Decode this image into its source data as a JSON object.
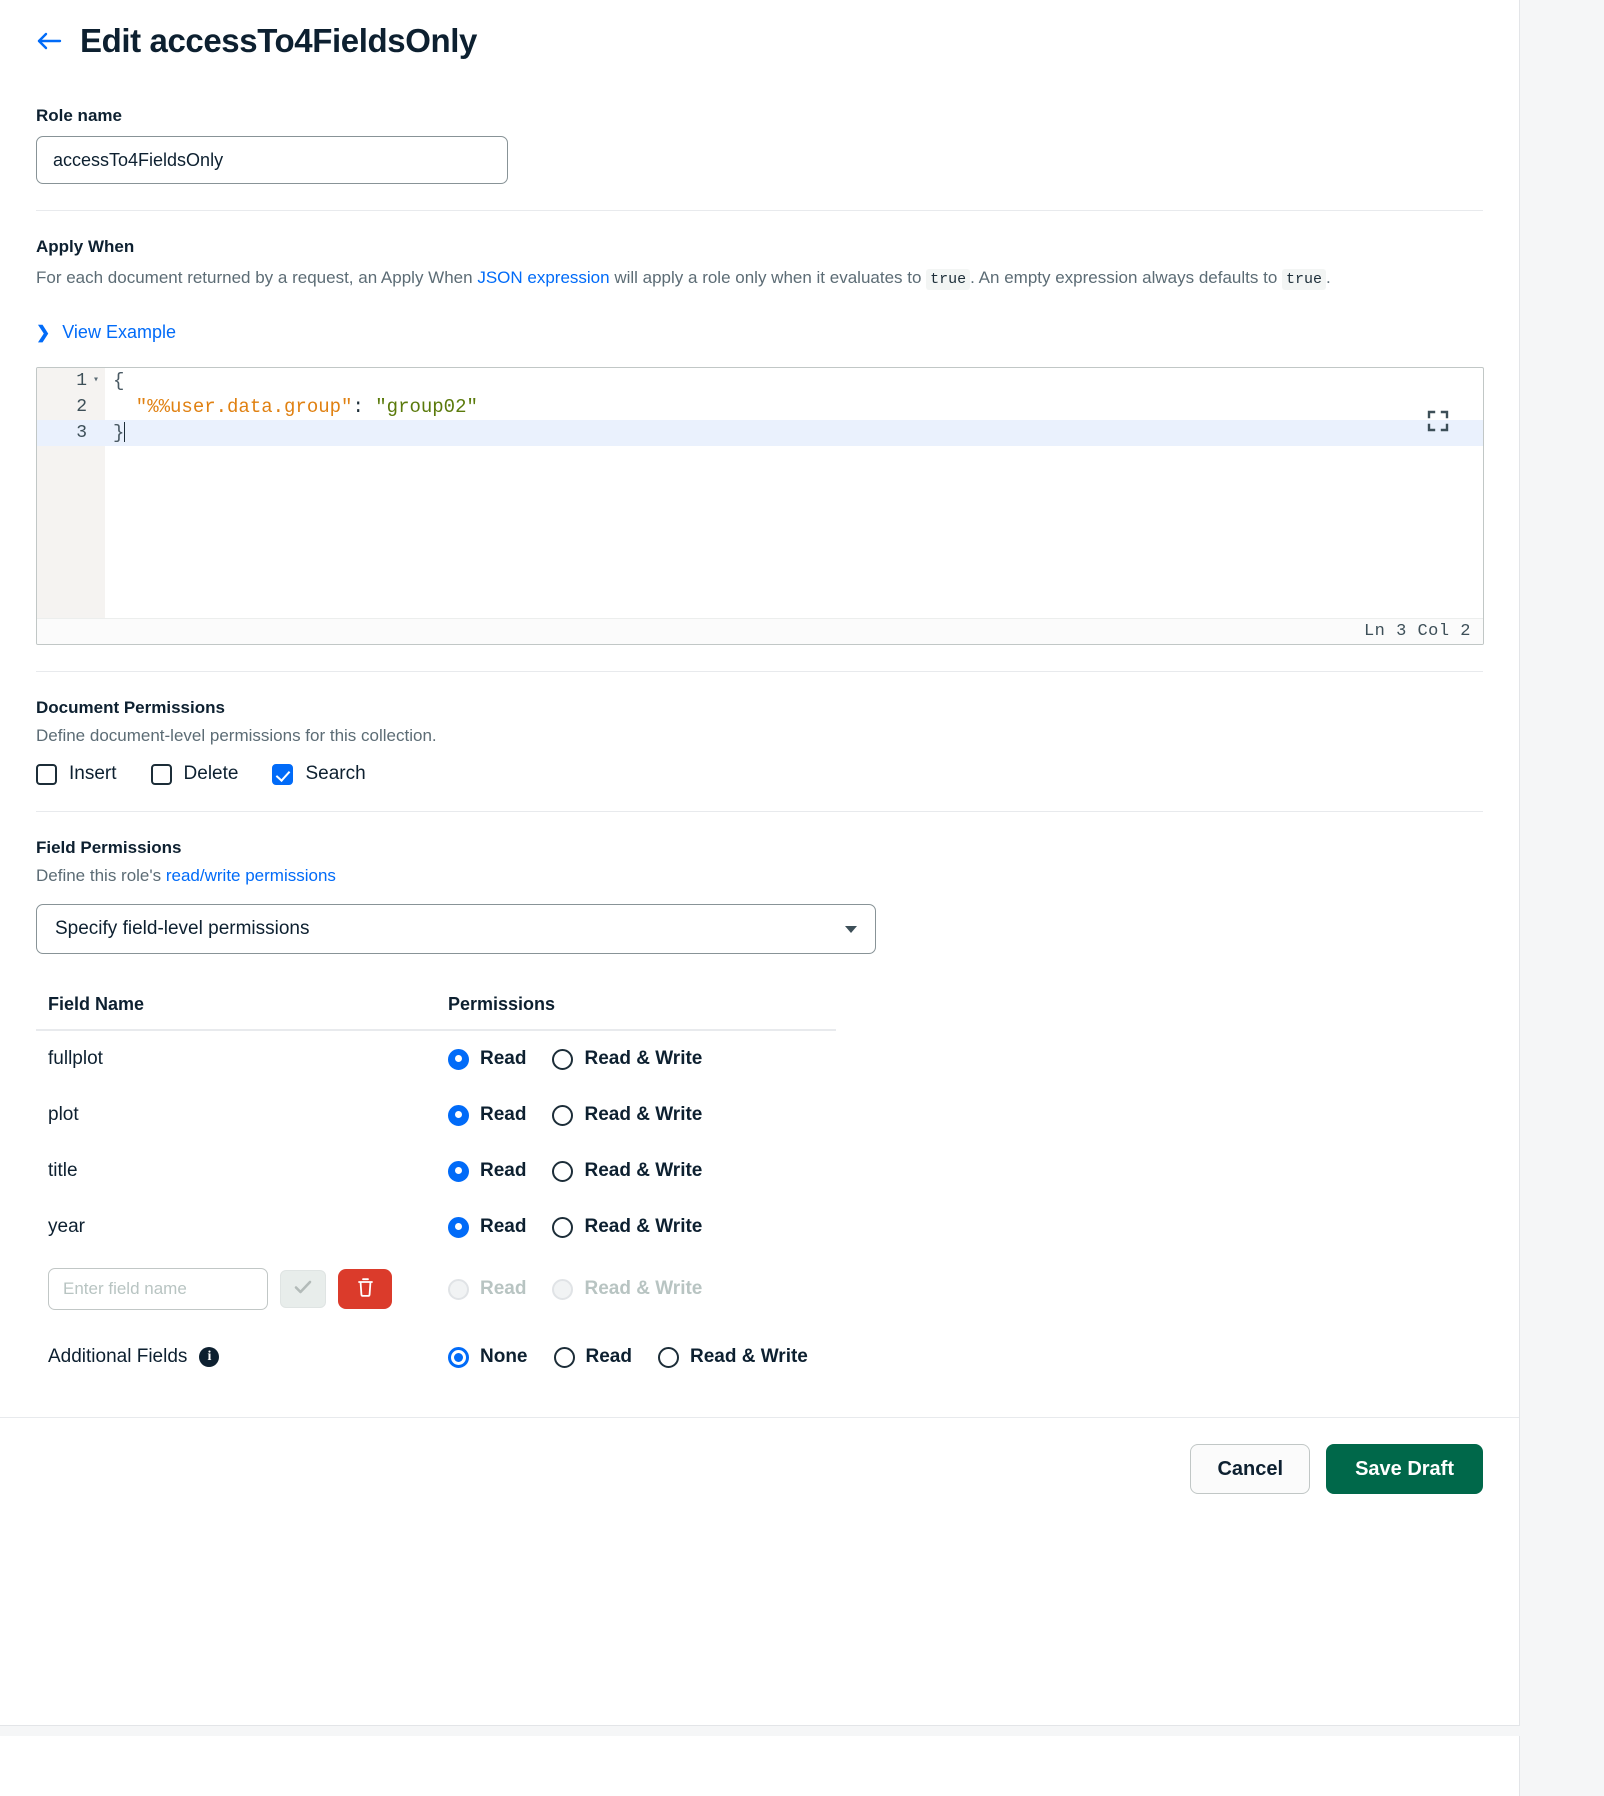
{
  "header": {
    "back_icon": "arrow-left-icon",
    "title": "Edit accessTo4FieldsOnly"
  },
  "role_name": {
    "label": "Role name",
    "value": "accessTo4FieldsOnly",
    "placeholder": "Role name"
  },
  "apply_when": {
    "heading": "Apply When",
    "desc_part1": "For each document returned by a request, an Apply When ",
    "desc_link": "JSON expression",
    "desc_part2": " will apply a role only when it evaluates to ",
    "code_true_1": "true",
    "desc_part3": ". An empty expression always defaults to ",
    "code_true_2": "true",
    "desc_part4": ".",
    "view_example_label": "View Example",
    "view_example_icon": "chevron-right-icon",
    "editor": {
      "lines": [
        {
          "num": "1",
          "fold": "▾",
          "active": false,
          "tokens": [
            {
              "cls": "tok-punct",
              "text": "{"
            }
          ]
        },
        {
          "num": "2",
          "fold": "",
          "active": false,
          "tokens": [
            {
              "cls": "tok-key",
              "text": "  \"%%user.data.group\""
            },
            {
              "cls": "tok-colon",
              "text": ":"
            },
            {
              "cls": "tok-str",
              "text": " \"group02\""
            }
          ]
        },
        {
          "num": "3",
          "fold": "",
          "active": true,
          "tokens": [
            {
              "cls": "tok-punct",
              "text": "}"
            }
          ]
        }
      ],
      "raw_text": "{\n  \"%%user.data.group\": \"group02\"\n}",
      "expand_icon": "fullscreen-expand-icon",
      "status": "Ln 3 Col 2"
    }
  },
  "document_permissions": {
    "heading": "Document Permissions",
    "subtitle": "Define document-level permissions for this collection.",
    "checkboxes": [
      {
        "label": "Insert",
        "checked": false
      },
      {
        "label": "Delete",
        "checked": false
      },
      {
        "label": "Search",
        "checked": true
      }
    ]
  },
  "field_permissions": {
    "heading": "Field Permissions",
    "subtitle_prefix": "Define this role's ",
    "subtitle_link": "read/write permissions",
    "select_value": "Specify field-level permissions",
    "select_icon": "chevron-down-icon",
    "table": {
      "columns": [
        "Field Name",
        "Permissions"
      ],
      "rows": [
        {
          "field": "fullplot",
          "options": [
            {
              "label": "Read",
              "state": "selected"
            },
            {
              "label": "Read & Write",
              "state": "unselected"
            }
          ]
        },
        {
          "field": "plot",
          "options": [
            {
              "label": "Read",
              "state": "selected"
            },
            {
              "label": "Read & Write",
              "state": "unselected"
            }
          ]
        },
        {
          "field": "title",
          "options": [
            {
              "label": "Read",
              "state": "selected"
            },
            {
              "label": "Read & Write",
              "state": "unselected"
            }
          ]
        },
        {
          "field": "year",
          "options": [
            {
              "label": "Read",
              "state": "selected"
            },
            {
              "label": "Read & Write",
              "state": "unselected"
            }
          ]
        }
      ],
      "new_row": {
        "input_value": "",
        "input_placeholder": "Enter field name",
        "confirm_icon": "check-icon",
        "delete_icon": "trash-icon",
        "options": [
          {
            "label": "Read",
            "state": "disabled"
          },
          {
            "label": "Read & Write",
            "state": "disabled"
          }
        ]
      },
      "additional_fields": {
        "label": "Additional Fields",
        "info_icon": "info-icon",
        "info_glyph": "i",
        "options": [
          {
            "label": "None",
            "state": "ring"
          },
          {
            "label": "Read",
            "state": "unselected"
          },
          {
            "label": "Read & Write",
            "state": "unselected"
          }
        ]
      }
    }
  },
  "footer": {
    "cancel_label": "Cancel",
    "save_label": "Save Draft"
  },
  "colors": {
    "accent_blue": "#016bf8",
    "save_green": "#00684a",
    "delete_red": "#db3b2b",
    "text_dark": "#0d2030",
    "text_muted": "#5c6c75"
  }
}
